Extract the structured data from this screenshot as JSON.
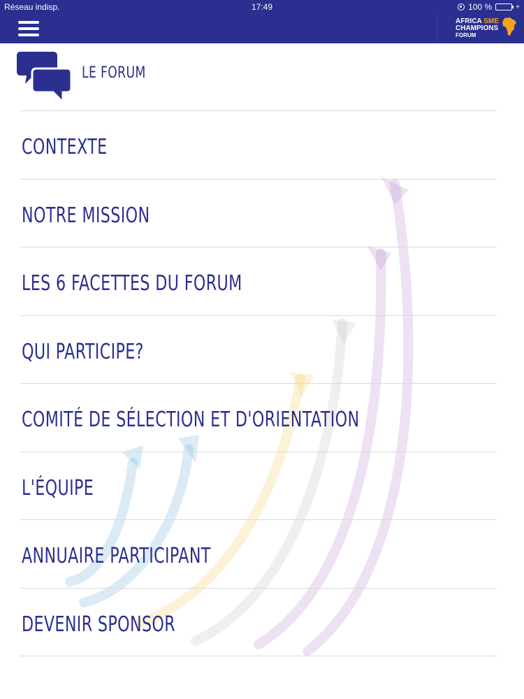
{
  "status_bar": {
    "carrier": "Réseau indisp.",
    "time": "17:49",
    "battery": "100 %"
  },
  "navbar": {
    "logo": {
      "line1_a": "AFRICA",
      "line1_b": "SME",
      "line2": "CHAMPIONS",
      "line3": "FORUM"
    }
  },
  "header": {
    "icon": "chat-bubbles-icon",
    "title": "LE FORUM"
  },
  "menu": {
    "items": [
      {
        "label": "CONTEXTE"
      },
      {
        "label": "NOTRE MISSION"
      },
      {
        "label": "LES 6 FACETTES DU FORUM"
      },
      {
        "label": "QUI PARTICIPE?"
      },
      {
        "label": "COMITÉ DE SÉLECTION ET D'ORIENTATION"
      },
      {
        "label": "L'ÉQUIPE"
      },
      {
        "label": "ANNUAIRE PARTICIPANT"
      },
      {
        "label": "DEVENIR SPONSOR"
      }
    ]
  },
  "colors": {
    "brand_blue": "#2b2f8f",
    "accent_orange": "#f4a21e",
    "divider": "#d9d9d9"
  }
}
